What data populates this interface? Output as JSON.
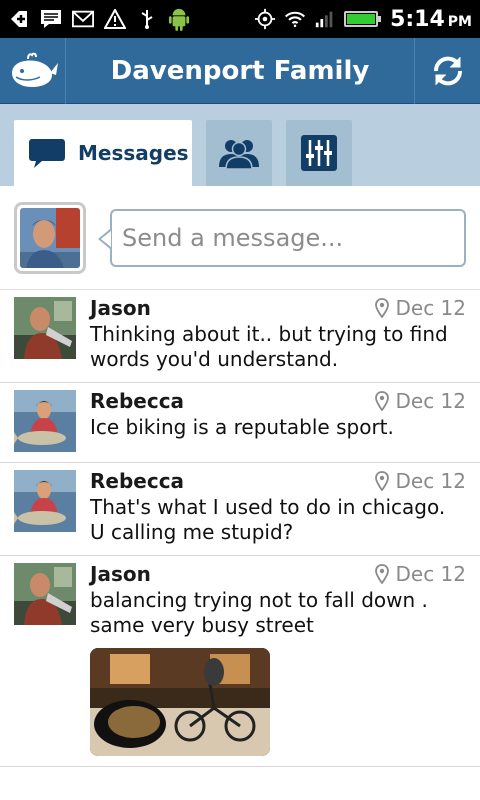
{
  "status_bar": {
    "icons_left": [
      "add-icon",
      "message-icon",
      "gmail-icon",
      "warning-icon",
      "usb-icon",
      "android-icon"
    ],
    "icons_right": [
      "gps-icon",
      "wifi-icon",
      "signal-icon",
      "battery-icon"
    ],
    "time": "5:14",
    "ampm": "PM",
    "battery_level": 1.0,
    "battery_color": "#33cc33"
  },
  "header": {
    "title": "Davenport Family",
    "logo_icon": "whale-logo-icon",
    "refresh_icon": "refresh-icon",
    "color": "#2f6a9b"
  },
  "tabs": [
    {
      "label": "Messages",
      "icon": "chat-bubble-icon",
      "active": true
    },
    {
      "label": "",
      "icon": "people-icon",
      "active": false
    },
    {
      "label": "",
      "icon": "settings-sliders-icon",
      "active": false
    }
  ],
  "composer": {
    "placeholder": "Send a message..."
  },
  "messages": [
    {
      "sender": "Jason",
      "date": "Dec 12",
      "text": "Thinking about it.. but trying to find words you'd understand."
    },
    {
      "sender": "Rebecca",
      "date": "Dec 12",
      "text": "Ice biking is a reputable sport."
    },
    {
      "sender": "Rebecca",
      "date": "Dec 12",
      "text": "That's what I used to do in chicago. U calling me stupid?"
    },
    {
      "sender": "Jason",
      "date": "Dec 12",
      "text": "balancing trying not to fall down .  same very busy street",
      "has_photo": true
    }
  ]
}
